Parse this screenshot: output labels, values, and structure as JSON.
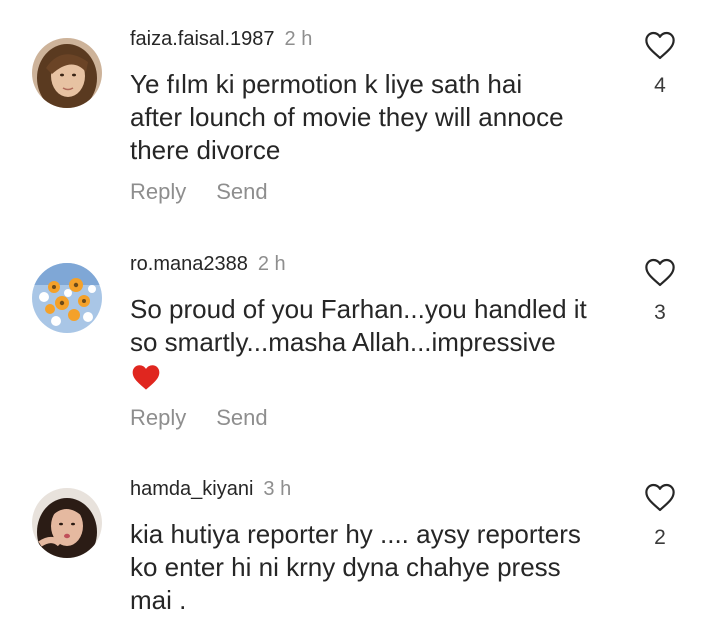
{
  "comments": [
    {
      "username": "faiza.faisal.1987",
      "time": "2 h",
      "text_lines": [
        "Ye fılm ki permotion k liye sath hai",
        "after lounch of movie they will annoce",
        "there divorce"
      ],
      "like_count": "4",
      "reply_label": "Reply",
      "send_label": "Send"
    },
    {
      "username": "ro.mana2388",
      "time": "2 h",
      "text_lines": [
        "So proud of you Farhan...you handled it",
        "so smartly...masha Allah...impressive"
      ],
      "emoji": "red-heart",
      "like_count": "3",
      "reply_label": "Reply",
      "send_label": "Send"
    },
    {
      "username": "hamda_kiyani",
      "time": "3 h",
      "text_lines": [
        "kia hutiya reporter hy .... aysy reporters",
        "ko enter hi ni krny dyna chahye press",
        "mai ."
      ],
      "like_count": "2"
    }
  ],
  "icons": {
    "like": "heart-outline-icon",
    "emoji": "red-heart-icon"
  },
  "colors": {
    "text": "#262626",
    "muted": "#8e8e8e",
    "heart_red": "#e0261f"
  }
}
